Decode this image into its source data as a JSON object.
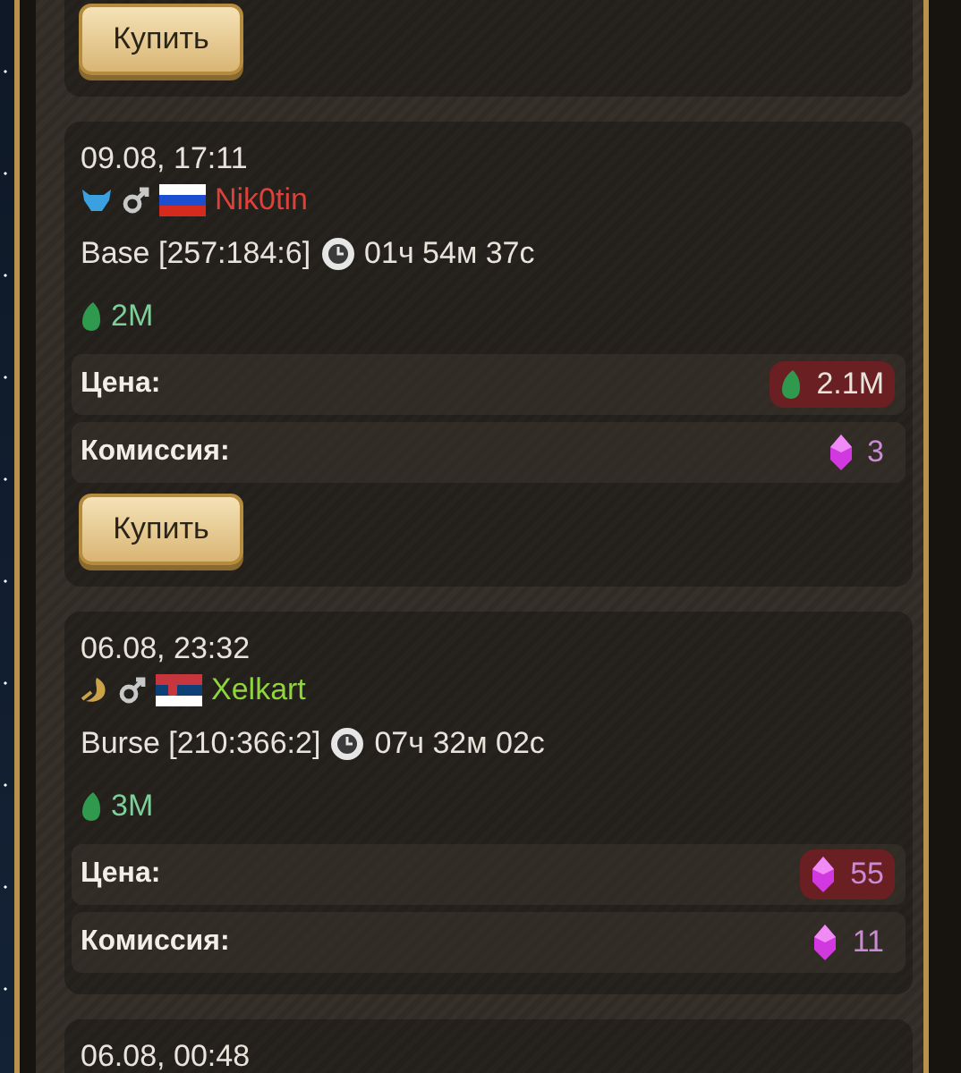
{
  "listings": [
    {
      "buy_button": "Купить"
    },
    {
      "date": "09.08, 17:11",
      "emblem": {
        "kind": "wolf"
      },
      "gender": {
        "kind": "male"
      },
      "flag": {
        "kind": "ru"
      },
      "player": "Nik0tin",
      "color": "#e0403a",
      "location": "Base [257:184:6]",
      "timer": "01ч 54м 37с",
      "amount": {
        "kind": "crystal",
        "value": "2M"
      },
      "rows": [
        {
          "label": "Цена:",
          "kind": "crystal",
          "value": "2.1M",
          "insufficient": true
        },
        {
          "label": "Комиссия:",
          "kind": "gem",
          "value": "3",
          "insufficient": false
        }
      ],
      "buy_button": "Купить"
    },
    {
      "date": "06.08, 23:32",
      "emblem": {
        "kind": "crescent"
      },
      "gender": {
        "kind": "male"
      },
      "flag": {
        "kind": "rs"
      },
      "player": "Xelkart",
      "color": "#8fd63a",
      "location": "Burse [210:366:2]",
      "timer": "07ч 32м 02с",
      "amount": {
        "kind": "crystal",
        "value": "3M"
      },
      "rows": [
        {
          "label": "Цена:",
          "kind": "gem",
          "value": "55",
          "insufficient": true
        },
        {
          "label": "Комиссия:",
          "kind": "gem",
          "value": "11",
          "insufficient": false
        }
      ]
    },
    {
      "date": "06.08, 00:48"
    }
  ]
}
